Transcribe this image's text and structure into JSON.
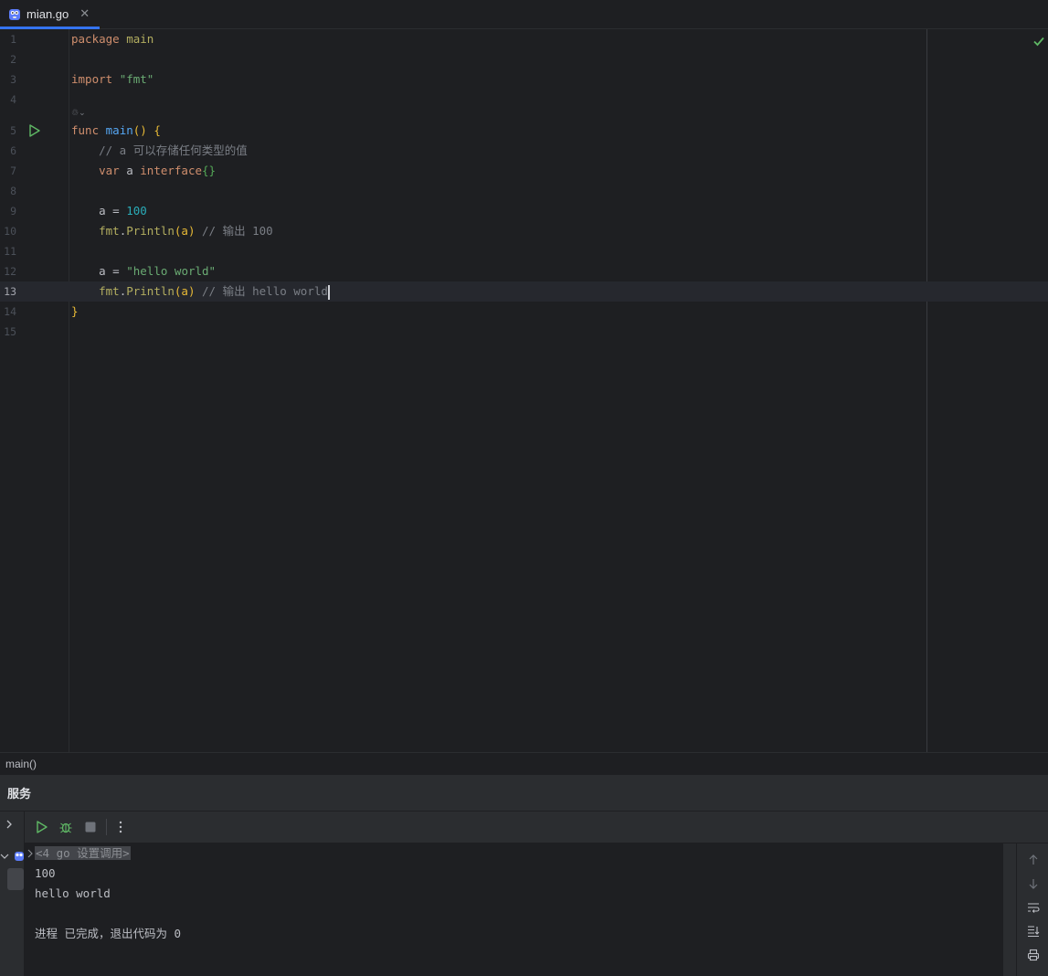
{
  "tab": {
    "label": "mian.go",
    "close_glyph": "✕",
    "icon": "go-gopher-icon"
  },
  "editor": {
    "line_numbers": [
      "1",
      "2",
      "3",
      "4",
      "5",
      "6",
      "7",
      "8",
      "9",
      "10",
      "11",
      "12",
      "13",
      "14",
      "15"
    ],
    "current_line": "13",
    "inlay_hint": "♲⌄",
    "lines": {
      "l1_kw": "package",
      "l1_name": "main",
      "l3_kw": "import",
      "l3_str": "\"fmt\"",
      "l5_kw": "func",
      "l5_fn": "main",
      "l5_paren": "()",
      "l5_brace": "{",
      "l6_cmt": "// a 可以存储任何类型的值",
      "l7_kw": "var",
      "l7_var": "a",
      "l7_type": "interface",
      "l7_braces": "{}",
      "l9_var": "a",
      "l9_eq": "=",
      "l9_num": "100",
      "l10_pkg": "fmt",
      "l10_dot": ".",
      "l10_fn": "Println",
      "l10_args": "(a)",
      "l10_cmt": "// 输出 100",
      "l12_var": "a",
      "l12_eq": "=",
      "l12_str": "\"hello world\"",
      "l13_pkg": "fmt",
      "l13_dot": ".",
      "l13_fn": "Println",
      "l13_args": "(a)",
      "l13_cmt": "// 输出 hello world",
      "l14_brace": "}"
    }
  },
  "breadcrumb": {
    "label": "main()"
  },
  "services": {
    "title": "服务",
    "console": {
      "command": "<4 go 设置调用>",
      "output": [
        "100",
        "hello world",
        "",
        "进程 已完成，退出代码为 0"
      ]
    }
  },
  "colors": {
    "accent": "#3574f0",
    "keyword": "#cf8e6d",
    "function": "#56a8f5",
    "string": "#6aab73",
    "number": "#2aacb8",
    "comment": "#7a7e85",
    "run_green": "#5fb865"
  }
}
